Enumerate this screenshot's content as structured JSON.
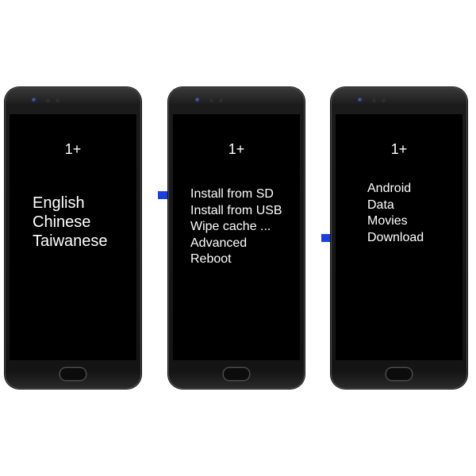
{
  "phones": [
    {
      "brand": "1+",
      "menu_items": [
        "English",
        "Chinese",
        "Taiwanese"
      ]
    },
    {
      "brand": "1+",
      "menu_items": [
        "Install from SD",
        "Install from USB",
        "Wipe cache ...",
        "Advanced",
        "Reboot"
      ],
      "selected_index": 0
    },
    {
      "brand": "1+",
      "menu_items": [
        "Android",
        "Data",
        "Movies",
        "Download"
      ],
      "selected_index": 3
    }
  ],
  "icons": {
    "pointer": "right-arrow-icon",
    "camera": "front-camera-icon"
  },
  "colors": {
    "arrow": "#1b3fe0",
    "screen": "#000000",
    "text": "#ffffff",
    "bezel": "#1b1b1b"
  }
}
